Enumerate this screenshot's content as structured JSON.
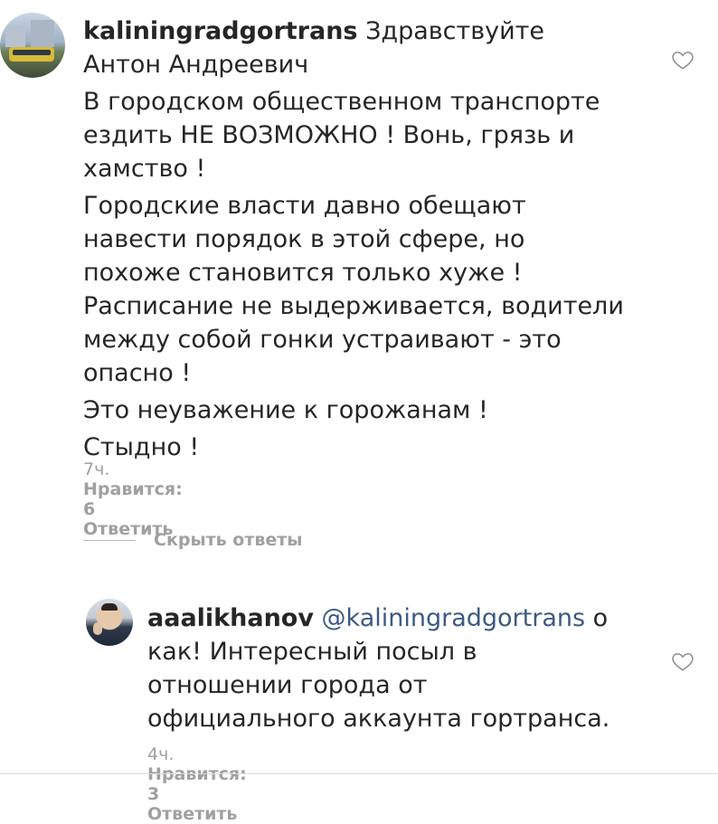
{
  "main_comment": {
    "username": "kaliningradgortrans",
    "greeting": "Здравствуйте Антон Андреевич",
    "paragraphs": [
      "В городском общественном транспорте ездить НЕ ВОЗМОЖНО !  Вонь, грязь и хамство !",
      "Городские власти давно обещают навести порядок в этой сфере, но похоже становится только хуже ! Расписание не выдерживается, водители между собой гонки устраивают - это опасно !",
      "Это неуважение к горожанам !",
      "Стыдно !"
    ],
    "time": "7ч.",
    "likes": "Нравится: 6",
    "reply": "Ответить"
  },
  "hide_replies": "Скрыть ответы",
  "reply_comment": {
    "username": "aaalikhanov",
    "mention": "@kaliningradgortrans",
    "text": "о как! Интересный посыл в отношении города от официального аккаунта гортранса.",
    "time": "4ч.",
    "likes": "Нравится: 3",
    "reply": "Ответить"
  },
  "icons": {
    "like": "heart-outline-icon"
  }
}
